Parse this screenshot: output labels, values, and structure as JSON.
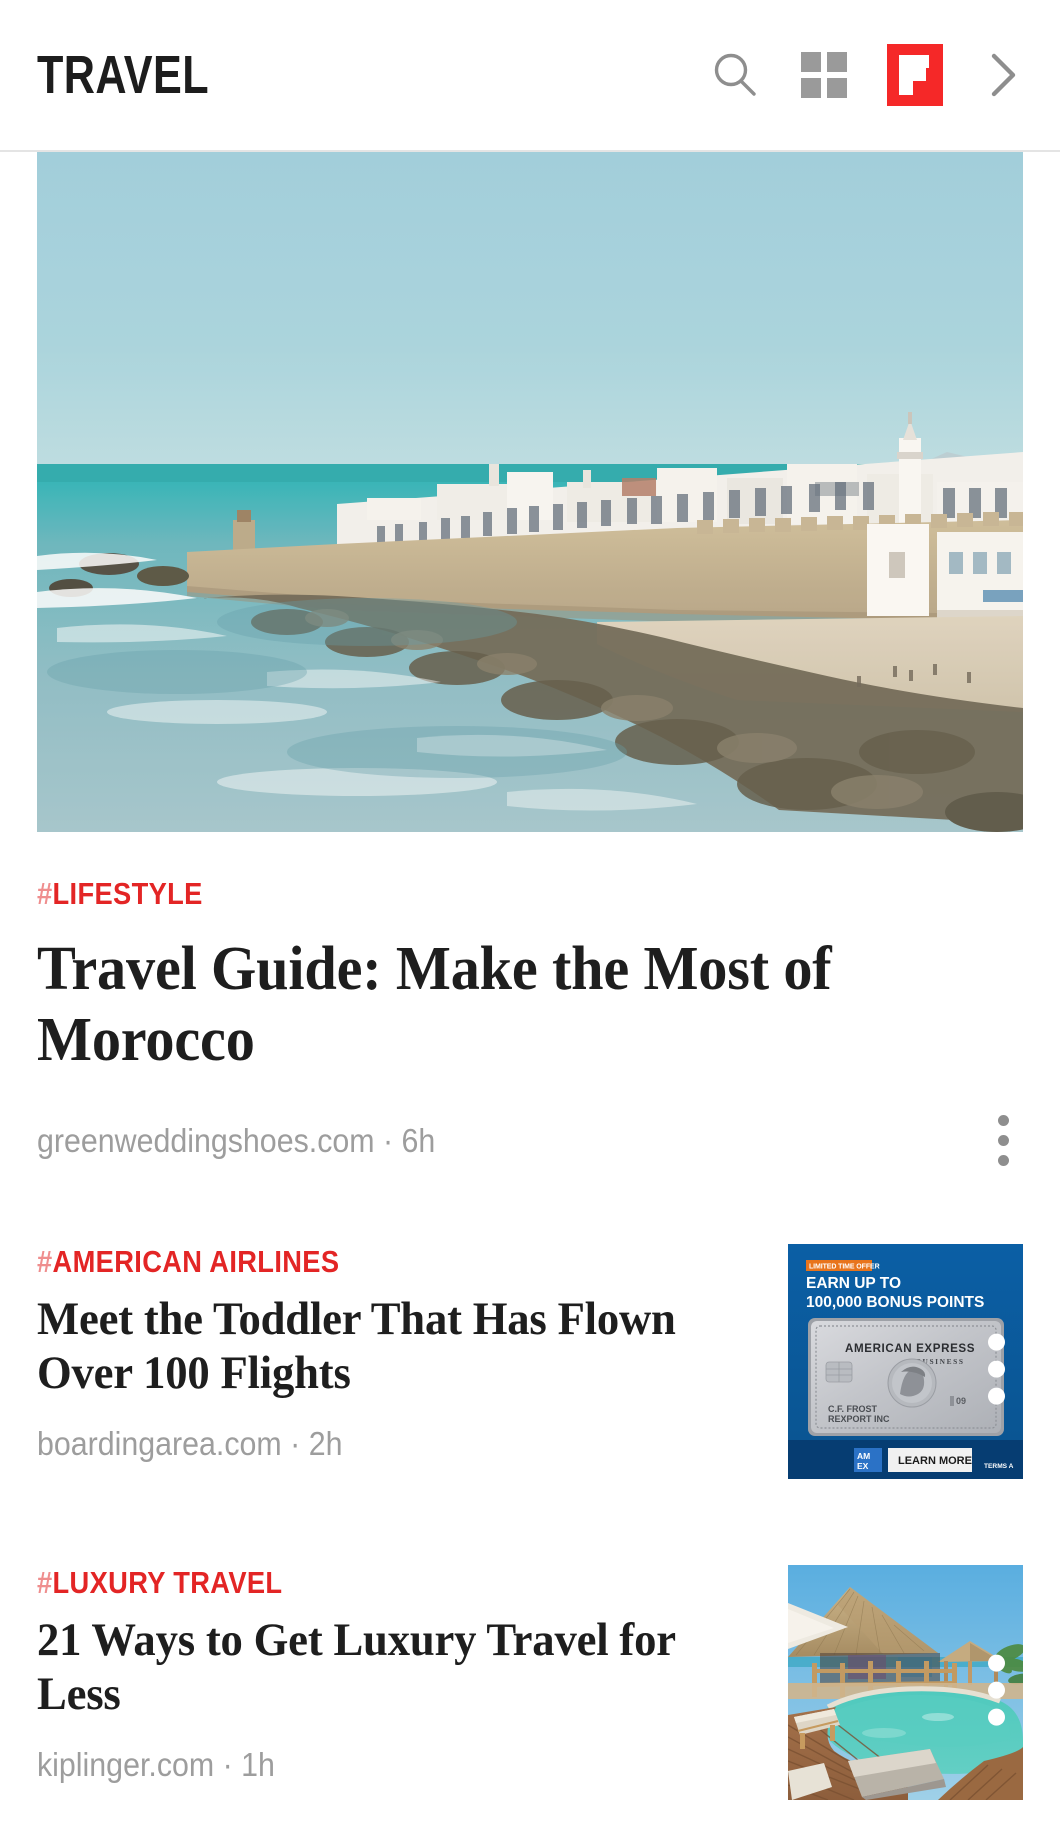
{
  "header": {
    "title": "TRAVEL",
    "search_label": "Search",
    "grid_label": "Sections",
    "flipboard_label": "Flipboard",
    "next_label": "Next"
  },
  "colors": {
    "accent_red": "#e32525",
    "brand_red": "#f52828",
    "hash_red": "#ef8e8e",
    "meta_gray": "#9d9d9d",
    "headline_black": "#1e1e1e"
  },
  "feed": {
    "hero": {
      "kicker_hash": "#",
      "kicker": "LIFESTYLE",
      "headline": "Travel Guide: Make the Most of Morocco",
      "source": "greenweddingshoes.com",
      "separator": "·",
      "time": "6h",
      "meta": "greenweddingshoes.com · 6h",
      "image_alt": "Coastal walled medina of Essaouira, Morocco, seen from the sea"
    },
    "items": [
      {
        "kicker_hash": "#",
        "kicker": "AMERICAN AIRLINES",
        "headline": "Meet the Toddler That Has Flown Over 100 Flights",
        "source": "boardingarea.com",
        "separator": "·",
        "time": "2h",
        "meta": "boardingarea.com · 2h",
        "thumb_type": "ad",
        "ad": {
          "badge": "LIMITED TIME OFFER",
          "line1": "EARN UP TO",
          "line2": "100,000 BONUS POINTS",
          "card_brand": "AMERICAN EXPRESS",
          "card_tier": "BUSINESS",
          "card_name_line1": "C.F. FROST",
          "card_name_line2": "REXPORT INC",
          "card_code": "09",
          "logo": "AM EX",
          "cta": "LEARN MORE",
          "terms": "TERMS A"
        }
      },
      {
        "kicker_hash": "#",
        "kicker": "LUXURY TRAVEL",
        "headline": "21 Ways to Get Luxury Travel for Less",
        "source": "kiplinger.com",
        "separator": "·",
        "time": "1h",
        "meta": "kiplinger.com · 1h",
        "thumb_type": "photo",
        "image_alt": "Tropical resort pool with thatched palapa, wooden deck and loungers"
      }
    ]
  }
}
